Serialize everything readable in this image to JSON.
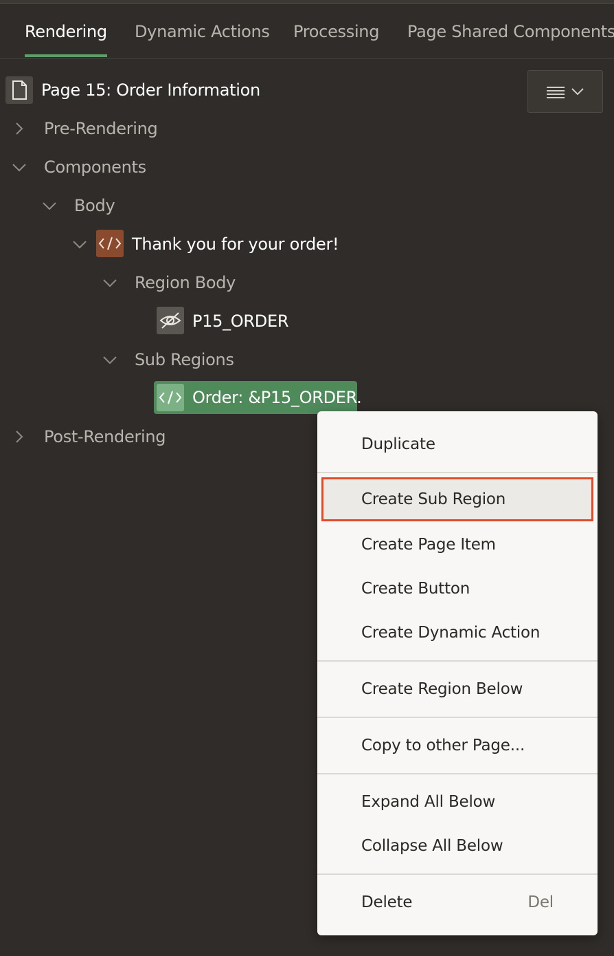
{
  "tabs": [
    {
      "label": "Rendering",
      "active": true
    },
    {
      "label": "Dynamic Actions",
      "active": false
    },
    {
      "label": "Processing",
      "active": false
    },
    {
      "label": "Page Shared Components",
      "active": false
    }
  ],
  "tree": {
    "page_title": "Page 15: Order Information",
    "pre_rendering": "Pre-Rendering",
    "components": "Components",
    "body": "Body",
    "region": "Thank you for your order!",
    "region_body": "Region Body",
    "page_item": "P15_ORDER",
    "sub_regions": "Sub Regions",
    "selected_region": "Order: &P15_ORDER.",
    "post_rendering": "Post-Rendering"
  },
  "context_menu": {
    "duplicate": "Duplicate",
    "create_sub_region": "Create Sub Region",
    "create_page_item": "Create Page Item",
    "create_button": "Create Button",
    "create_dynamic_action": "Create Dynamic Action",
    "create_region_below": "Create Region Below",
    "copy_to_other_page": "Copy to other Page...",
    "expand_all_below": "Expand All Below",
    "collapse_all_below": "Collapse All Below",
    "delete": "Delete",
    "delete_shortcut": "Del"
  },
  "colors": {
    "background": "#2f2c29",
    "active_tab_underline": "#5e9c6a",
    "region_badge": "#8a4a2e",
    "selected_row": "#4f8a5b",
    "highlight_border": "#e04b2a"
  },
  "icons": [
    "page-icon",
    "chevron-right-icon",
    "chevron-down-icon",
    "code-region-icon",
    "hidden-item-icon",
    "hamburger-icon"
  ]
}
